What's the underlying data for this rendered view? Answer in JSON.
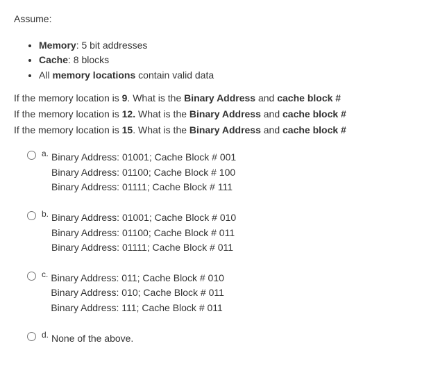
{
  "intro": "Assume:",
  "bullets": [
    {
      "label": "Memory",
      "rest": ": 5 bit addresses"
    },
    {
      "label": "Cache",
      "rest": ": 8 blocks"
    },
    {
      "prefix": "All ",
      "label": "memory locations",
      "rest": " contain valid data"
    }
  ],
  "questions": [
    {
      "p1": "If the memory location is ",
      "num": "9",
      "p2": ". What is the ",
      "b1": "Binary Address",
      "p3": " and ",
      "b2": "cache block #"
    },
    {
      "p1": "If the memory location is ",
      "num": "12.",
      "p2": " What is the ",
      "b1": "Binary Address",
      "p3": " and ",
      "b2": "cache block #"
    },
    {
      "p1": "If the memory location is ",
      "num": "15",
      "p2": ". What is the ",
      "b1": "Binary Address",
      "p3": " and ",
      "b2": "cache block #"
    }
  ],
  "options": [
    {
      "letter": "a.",
      "lines": [
        "Binary Address: 01001; Cache Block # 001",
        "Binary Address: 01100; Cache Block # 100",
        "Binary Address:  01111; Cache Block # 111"
      ]
    },
    {
      "letter": "b.",
      "lines": [
        "Binary Address: 01001; Cache Block # 010",
        "Binary Address: 01100; Cache Block # 011",
        "Binary Address:  01111; Cache Block # 011"
      ]
    },
    {
      "letter": "c.",
      "lines": [
        "Binary Address: 011; Cache Block # 010",
        "Binary Address: 010; Cache Block # 011",
        "Binary Address:  111; Cache Block # 011"
      ]
    },
    {
      "letter": "d.",
      "lines": [
        "None of the above."
      ]
    }
  ]
}
